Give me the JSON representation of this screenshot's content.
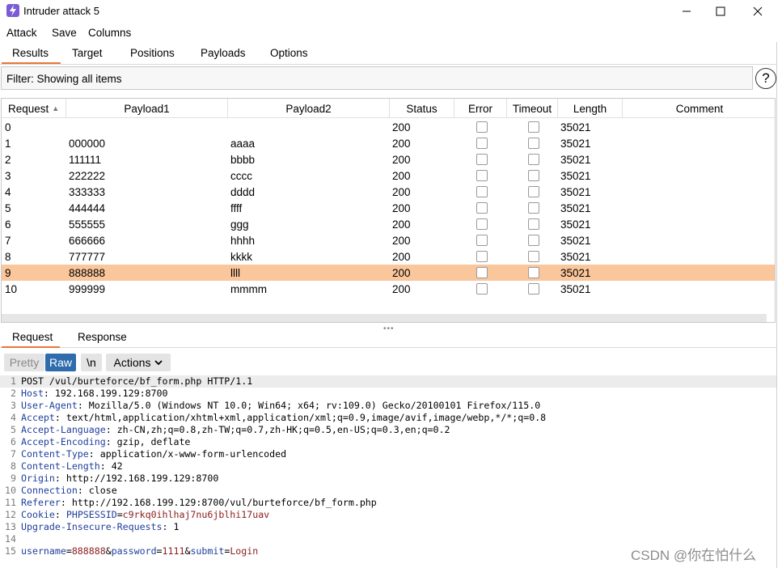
{
  "window": {
    "title": "Intruder attack 5",
    "accent_color": "#e8773a",
    "selected_row_color": "#fac69b"
  },
  "menu": [
    "Attack",
    "Save",
    "Columns"
  ],
  "top_tabs": [
    "Results",
    "Target",
    "Positions",
    "Payloads",
    "Options"
  ],
  "filter": {
    "text": "Filter: Showing all items",
    "help": "?"
  },
  "table": {
    "columns": [
      "Request",
      "Payload1",
      "Payload2",
      "Status",
      "Error",
      "Timeout",
      "Length",
      "Comment"
    ],
    "sorted_column": "Request",
    "selected_row": 9,
    "rows": [
      {
        "request": "0",
        "payload1": "",
        "payload2": "",
        "status": "200",
        "error": false,
        "timeout": false,
        "length": "35021",
        "comment": ""
      },
      {
        "request": "1",
        "payload1": "000000",
        "payload2": "aaaa",
        "status": "200",
        "error": false,
        "timeout": false,
        "length": "35021",
        "comment": ""
      },
      {
        "request": "2",
        "payload1": "111111",
        "payload2": "bbbb",
        "status": "200",
        "error": false,
        "timeout": false,
        "length": "35021",
        "comment": ""
      },
      {
        "request": "3",
        "payload1": "222222",
        "payload2": "cccc",
        "status": "200",
        "error": false,
        "timeout": false,
        "length": "35021",
        "comment": ""
      },
      {
        "request": "4",
        "payload1": "333333",
        "payload2": "dddd",
        "status": "200",
        "error": false,
        "timeout": false,
        "length": "35021",
        "comment": ""
      },
      {
        "request": "5",
        "payload1": "444444",
        "payload2": "ffff",
        "status": "200",
        "error": false,
        "timeout": false,
        "length": "35021",
        "comment": ""
      },
      {
        "request": "6",
        "payload1": "555555",
        "payload2": "ggg",
        "status": "200",
        "error": false,
        "timeout": false,
        "length": "35021",
        "comment": ""
      },
      {
        "request": "7",
        "payload1": "666666",
        "payload2": "hhhh",
        "status": "200",
        "error": false,
        "timeout": false,
        "length": "35021",
        "comment": ""
      },
      {
        "request": "8",
        "payload1": "777777",
        "payload2": "kkkk",
        "status": "200",
        "error": false,
        "timeout": false,
        "length": "35021",
        "comment": ""
      },
      {
        "request": "9",
        "payload1": "888888",
        "payload2": "llll",
        "status": "200",
        "error": false,
        "timeout": false,
        "length": "35021",
        "comment": ""
      },
      {
        "request": "10",
        "payload1": "999999",
        "payload2": "mmmm",
        "status": "200",
        "error": false,
        "timeout": false,
        "length": "35021",
        "comment": ""
      }
    ]
  },
  "bottom_tabs": [
    "Request",
    "Response"
  ],
  "toolbar": {
    "pretty": "Pretty",
    "raw": "Raw",
    "newline": "\\n",
    "actions": "Actions"
  },
  "request_lines": [
    {
      "n": "1",
      "plain": "POST /vul/burteforce/bf_form.php HTTP/1.1"
    },
    {
      "n": "2",
      "key": "Host",
      "value": "192.168.199.129:8700"
    },
    {
      "n": "3",
      "key": "User-Agent",
      "value": "Mozilla/5.0 (Windows NT 10.0; Win64; x64; rv:109.0) Gecko/20100101 Firefox/115.0"
    },
    {
      "n": "4",
      "key": "Accept",
      "value": "text/html,application/xhtml+xml,application/xml;q=0.9,image/avif,image/webp,*/*;q=0.8"
    },
    {
      "n": "5",
      "key": "Accept-Language",
      "value": "zh-CN,zh;q=0.8,zh-TW;q=0.7,zh-HK;q=0.5,en-US;q=0.3,en;q=0.2"
    },
    {
      "n": "6",
      "key": "Accept-Encoding",
      "value": "gzip, deflate"
    },
    {
      "n": "7",
      "key": "Content-Type",
      "value": "application/x-www-form-urlencoded"
    },
    {
      "n": "8",
      "key": "Content-Length",
      "value": "42"
    },
    {
      "n": "9",
      "key": "Origin",
      "value": "http://192.168.199.129:8700"
    },
    {
      "n": "10",
      "key": "Connection",
      "value": "close"
    },
    {
      "n": "11",
      "key": "Referer",
      "value": "http://192.168.199.129:8700/vul/burteforce/bf_form.php"
    },
    {
      "n": "12",
      "key": "Cookie",
      "cookie_name": "PHPSESSID",
      "cookie_value": "c9rkq0ihlhaj7nu6jblhi17uav"
    },
    {
      "n": "13",
      "key": "Upgrade-Insecure-Requests",
      "value": "1"
    },
    {
      "n": "14"
    },
    {
      "n": "15",
      "body": [
        {
          "k": "username",
          "v": "888888"
        },
        {
          "k": "password",
          "v": "1111"
        },
        {
          "k": "submit",
          "v": "Login"
        }
      ]
    }
  ],
  "watermark": "CSDN @你在怕什么"
}
